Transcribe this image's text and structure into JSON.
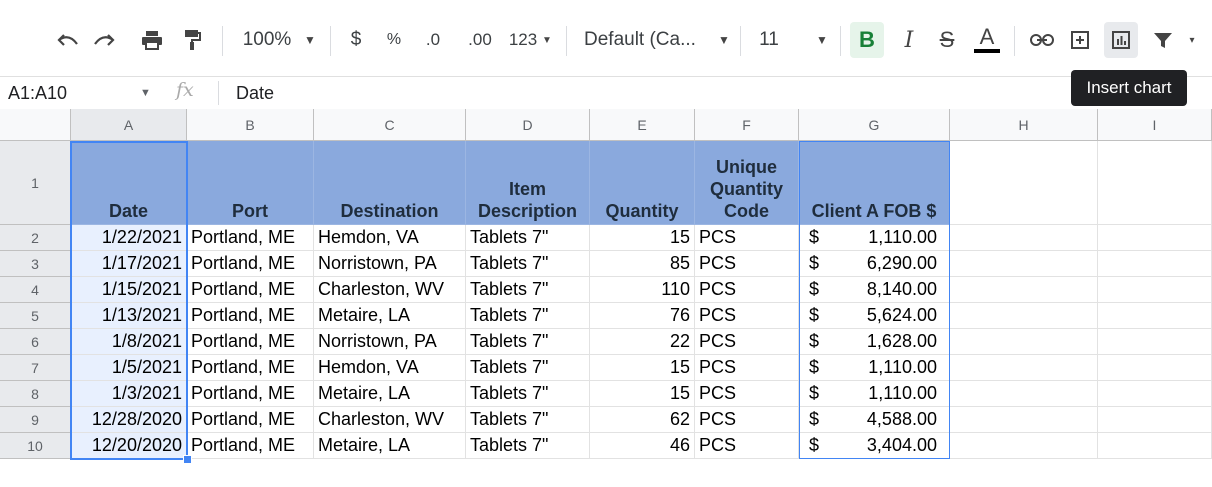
{
  "toolbar": {
    "zoom": "100%",
    "currency": "$",
    "percent": "%",
    "dec_decrease": ".0",
    "dec_increase": ".00",
    "more_formats": "123",
    "font": "Default (Ca...",
    "font_size": "11",
    "bold": "B",
    "italic": "I",
    "strike": "S",
    "text_color": "A",
    "icons": [
      "undo-icon",
      "redo-icon",
      "print-icon",
      "paint-format-icon",
      "link-icon",
      "comment-icon",
      "insert-chart-icon",
      "filter-icon"
    ]
  },
  "tooltip": "Insert chart",
  "formula_bar": {
    "name_box": "A1:A10",
    "fx": "fx",
    "content": "Date"
  },
  "columns": [
    "A",
    "B",
    "C",
    "D",
    "E",
    "F",
    "G",
    "H",
    "I"
  ],
  "header_row": {
    "date": "Date",
    "port": "Port",
    "destination": "Destination",
    "item": "Item Description",
    "quantity": "Quantity",
    "unique": "Unique Quantity Code",
    "fob": "Client A FOB $"
  },
  "rows": [
    {
      "num": "2",
      "date": "1/22/2021",
      "port": "Portland, ME",
      "dest": "Hemdon, VA",
      "item": "Tablets 7\"",
      "qty": "15",
      "code": "PCS",
      "cur": "$",
      "fob": "1,110.00"
    },
    {
      "num": "3",
      "date": "1/17/2021",
      "port": "Portland, ME",
      "dest": "Norristown, PA",
      "item": "Tablets 7\"",
      "qty": "85",
      "code": "PCS",
      "cur": "$",
      "fob": "6,290.00"
    },
    {
      "num": "4",
      "date": "1/15/2021",
      "port": "Portland, ME",
      "dest": "Charleston, WV",
      "item": "Tablets 7\"",
      "qty": "110",
      "code": "PCS",
      "cur": "$",
      "fob": "8,140.00"
    },
    {
      "num": "5",
      "date": "1/13/2021",
      "port": "Portland, ME",
      "dest": "Metaire, LA",
      "item": "Tablets 7\"",
      "qty": "76",
      "code": "PCS",
      "cur": "$",
      "fob": "5,624.00"
    },
    {
      "num": "6",
      "date": "1/8/2021",
      "port": "Portland, ME",
      "dest": "Norristown, PA",
      "item": "Tablets 7\"",
      "qty": "22",
      "code": "PCS",
      "cur": "$",
      "fob": "1,628.00"
    },
    {
      "num": "7",
      "date": "1/5/2021",
      "port": "Portland, ME",
      "dest": "Hemdon, VA",
      "item": "Tablets 7\"",
      "qty": "15",
      "code": "PCS",
      "cur": "$",
      "fob": "1,110.00"
    },
    {
      "num": "8",
      "date": "1/3/2021",
      "port": "Portland, ME",
      "dest": "Metaire, LA",
      "item": "Tablets 7\"",
      "qty": "15",
      "code": "PCS",
      "cur": "$",
      "fob": "1,110.00"
    },
    {
      "num": "9",
      "date": "12/28/2020",
      "port": "Portland, ME",
      "dest": "Charleston, WV",
      "item": "Tablets 7\"",
      "qty": "62",
      "code": "PCS",
      "cur": "$",
      "fob": "4,588.00"
    },
    {
      "num": "10",
      "date": "12/20/2020",
      "port": "Portland, ME",
      "dest": "Metaire, LA",
      "item": "Tablets 7\"",
      "qty": "46",
      "code": "PCS",
      "cur": "$",
      "fob": "3,404.00"
    }
  ],
  "row1_num": "1",
  "colors": {
    "header_fill": "#8aa9dd",
    "selection": "#4285f4",
    "bold_active": "#188038"
  }
}
